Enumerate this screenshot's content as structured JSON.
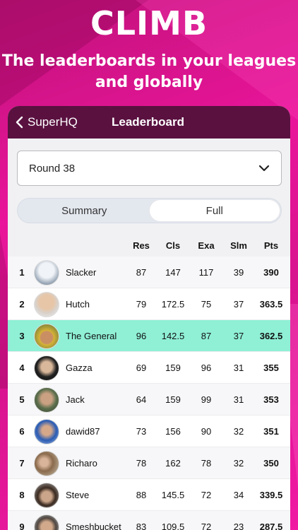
{
  "promo": {
    "headline": "CLIMB",
    "subline_1": "The leaderboards in your leagues",
    "subline_2": "and globally"
  },
  "nav": {
    "back_label": "SuperHQ",
    "title": "Leaderboard"
  },
  "round_select": {
    "value": "Round 38"
  },
  "tabs": {
    "summary": "Summary",
    "full": "Full",
    "active": "Full"
  },
  "columns": [
    "Res",
    "Cls",
    "Exa",
    "Slm",
    "Pts"
  ],
  "rows": [
    {
      "rank": "1",
      "name": "Slacker",
      "res": "87",
      "cls": "147",
      "exa": "117",
      "slm": "39",
      "pts": "390",
      "avatar": "avatar-snow",
      "highlight": false
    },
    {
      "rank": "2",
      "name": "Hutch",
      "res": "79",
      "cls": "172.5",
      "exa": "75",
      "slm": "37",
      "pts": "363.5",
      "avatar": "avatar-bald",
      "highlight": false
    },
    {
      "rank": "3",
      "name": "The General",
      "res": "96",
      "cls": "142.5",
      "exa": "87",
      "slm": "37",
      "pts": "362.5",
      "avatar": "avatar-cap",
      "highlight": true
    },
    {
      "rank": "4",
      "name": "Gazza",
      "res": "69",
      "cls": "159",
      "exa": "96",
      "slm": "31",
      "pts": "355",
      "avatar": "avatar-dark",
      "highlight": false
    },
    {
      "rank": "5",
      "name": "Jack",
      "res": "64",
      "cls": "159",
      "exa": "99",
      "slm": "31",
      "pts": "353",
      "avatar": "avatar-crowd",
      "highlight": false
    },
    {
      "rank": "6",
      "name": "dawid87",
      "res": "73",
      "cls": "156",
      "exa": "90",
      "slm": "32",
      "pts": "351",
      "avatar": "avatar-cyclist",
      "highlight": false
    },
    {
      "rank": "7",
      "name": "Richaro",
      "res": "78",
      "cls": "162",
      "exa": "78",
      "slm": "32",
      "pts": "350",
      "avatar": "avatar-group",
      "highlight": false
    },
    {
      "rank": "8",
      "name": "Steve",
      "res": "88",
      "cls": "145.5",
      "exa": "72",
      "slm": "34",
      "pts": "339.5",
      "avatar": "avatar-hat",
      "highlight": false
    },
    {
      "rank": "9",
      "name": "Smeshbucket",
      "res": "83",
      "cls": "109.5",
      "exa": "72",
      "slm": "23",
      "pts": "287.5",
      "avatar": "avatar-glasses",
      "highlight": false
    }
  ],
  "colors": {
    "brand_pink": "#e0148f",
    "nav_purple": "#5a1140",
    "highlight_row": "#8ff0d6"
  }
}
